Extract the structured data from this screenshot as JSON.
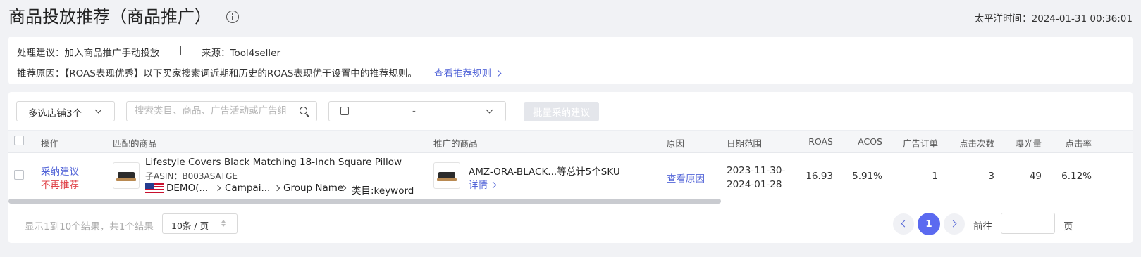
{
  "header": {
    "title": "商品投放推荐（商品推广）",
    "time_label": "太平洋时间：",
    "time_value": "2024-01-31 00:36:01"
  },
  "suggestion": {
    "action_label": "处理建议：",
    "action_value": "加入商品推广手动投放",
    "source_label": "来源：",
    "source_value": "Tool4seller",
    "reason_label": "推荐原因：",
    "reason_value": "【ROAS表现优秀】以下买家搜索词近期和历史的ROAS表现优于设置中的推荐规则。",
    "rules_link": "查看推荐规则"
  },
  "filters": {
    "shop_select": "多选店铺3个",
    "search_placeholder": "搜索类目、商品、广告活动或广告组",
    "date_separator": "-",
    "batch_button": "批量采纳建议"
  },
  "table": {
    "columns": {
      "action": "操作",
      "matched_product": "匹配的商品",
      "advertised_product": "推广的商品",
      "reason": "原因",
      "date_range": "日期范围",
      "roas": "ROAS",
      "acos": "ACOS",
      "ad_orders": "广告订单",
      "clicks": "点击次数",
      "impressions": "曝光量",
      "ctr": "点击率"
    },
    "rows": [
      {
        "accept": "采纳建议",
        "reject": "不再推荐",
        "product_title": "Lifestyle Covers Black Matching 18-Inch Square Pillow",
        "asin_label": "子ASIN：",
        "asin": "B003ASATGE",
        "shop": "DEMO(...",
        "campaign": "Campai...",
        "group": "Group Name",
        "category": "类目:keyword",
        "advertised_sku": "AMZ-ORA-BLACK...等总计5个SKU",
        "detail_link": "详情",
        "reason_link": "查看原因",
        "date_start": "2023-11-30-",
        "date_end": "2024-01-28",
        "roas": "16.93",
        "acos": "5.91%",
        "ad_orders": "1",
        "clicks": "3",
        "impressions": "49",
        "ctr": "6.12%"
      }
    ]
  },
  "footer": {
    "result_text": "显示1到10个结果，共1个结果",
    "page_size": "10条 / 页",
    "current_page": "1",
    "goto_label": "前往",
    "page_unit": "页"
  },
  "colors": {
    "accent": "#5b6af0",
    "link": "#5466d8",
    "danger": "#e0454b",
    "page_bg": "#f1f2f5"
  }
}
